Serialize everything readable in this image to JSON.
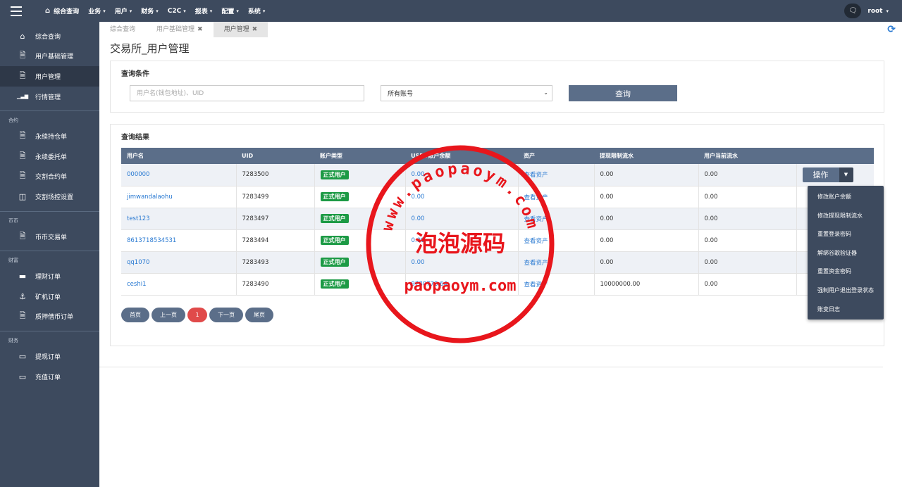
{
  "topbar": {
    "nav": [
      {
        "label": "综合查询",
        "home": true
      },
      {
        "label": "业务",
        "caret": true
      },
      {
        "label": "用户",
        "caret": true
      },
      {
        "label": "财务",
        "caret": true
      },
      {
        "label": "C2C",
        "caret": true
      },
      {
        "label": "报表",
        "caret": true
      },
      {
        "label": "配置",
        "caret": true
      },
      {
        "label": "系统",
        "caret": true
      }
    ],
    "user": "root"
  },
  "sidebar": {
    "items": [
      {
        "label": "综合查询",
        "icon": "home-icon"
      },
      {
        "label": "用户基础管理",
        "icon": "file-icon"
      },
      {
        "label": "用户管理",
        "icon": "file-icon",
        "active": true
      },
      {
        "label": "行情管理",
        "icon": "bar-chart-icon"
      }
    ],
    "groups": [
      {
        "title": "合约",
        "items": [
          {
            "label": "永续持仓单",
            "icon": "file-icon"
          },
          {
            "label": "永续委托单",
            "icon": "file-icon"
          },
          {
            "label": "交割合约单",
            "icon": "file-icon"
          },
          {
            "label": "交割场控设置",
            "icon": "columns-icon"
          }
        ]
      },
      {
        "title": "币币",
        "items": [
          {
            "label": "币币交易单",
            "icon": "file-icon"
          }
        ]
      },
      {
        "title": "财富",
        "items": [
          {
            "label": "理财订单",
            "icon": "folder-icon"
          },
          {
            "label": "矿机订单",
            "icon": "anchor-icon"
          },
          {
            "label": "质押借币订单",
            "icon": "file-icon"
          }
        ]
      },
      {
        "title": "财务",
        "items": [
          {
            "label": "提现订单",
            "icon": "card-icon"
          },
          {
            "label": "充值订单",
            "icon": "card-icon"
          }
        ]
      }
    ]
  },
  "tabs": [
    {
      "label": "综合查询",
      "closable": false,
      "active": false
    },
    {
      "label": "用户基础管理",
      "closable": true,
      "active": false
    },
    {
      "label": "用户管理",
      "closable": true,
      "active": true
    }
  ],
  "page_title": "交易所_用户管理",
  "query": {
    "title": "查询条件",
    "input_placeholder": "用户名(钱包地址)、UID",
    "select_value": "所有账号",
    "button": "查询"
  },
  "results": {
    "title": "查询结果",
    "columns": [
      "用户名",
      "UID",
      "账户类型",
      "USDT账户余额",
      "资产",
      "提现限制流水",
      "用户当前流水",
      ""
    ],
    "rows": [
      {
        "username": "000000",
        "uid": "7283500",
        "type": "正式用户",
        "balance": "0.00",
        "asset": "查看资产",
        "limit": "0.00",
        "flow": "0.00"
      },
      {
        "username": "jimwandalaohu",
        "uid": "7283499",
        "type": "正式用户",
        "balance": "0.00",
        "asset": "查看资产",
        "limit": "0.00",
        "flow": "0.00"
      },
      {
        "username": "test123",
        "uid": "7283497",
        "type": "正式用户",
        "balance": "0.00",
        "asset": "查看资产",
        "limit": "0.00",
        "flow": "0.00"
      },
      {
        "username": "8613718534531",
        "uid": "7283494",
        "type": "正式用户",
        "balance": "0.00",
        "asset": "查看资产",
        "limit": "0.00",
        "flow": "0.00"
      },
      {
        "username": "qq1070",
        "uid": "7283493",
        "type": "正式用户",
        "balance": "0.00",
        "asset": "查看资产",
        "limit": "0.00",
        "flow": "0.00"
      },
      {
        "username": "ceshi1",
        "uid": "7283490",
        "type": "正式用户",
        "balance": "9780778.64",
        "asset": "查看资产",
        "limit": "10000000.00",
        "flow": "0.00"
      }
    ],
    "op_button": "操作"
  },
  "pager": [
    "首页",
    "上一页",
    "1",
    "下一页",
    "尾页"
  ],
  "op_menu": [
    "修改账户余额",
    "修改提现限制流水",
    "重置登录密码",
    "解绑谷歌验证器",
    "重置资金密码",
    "强制用户退出登录状态",
    "账变日志"
  ],
  "watermark": {
    "arc_text": "www.paopaoym.com",
    "center_text": "泡泡源码",
    "bottom_text": "paopaoym.com",
    "color": "#e8161c"
  }
}
